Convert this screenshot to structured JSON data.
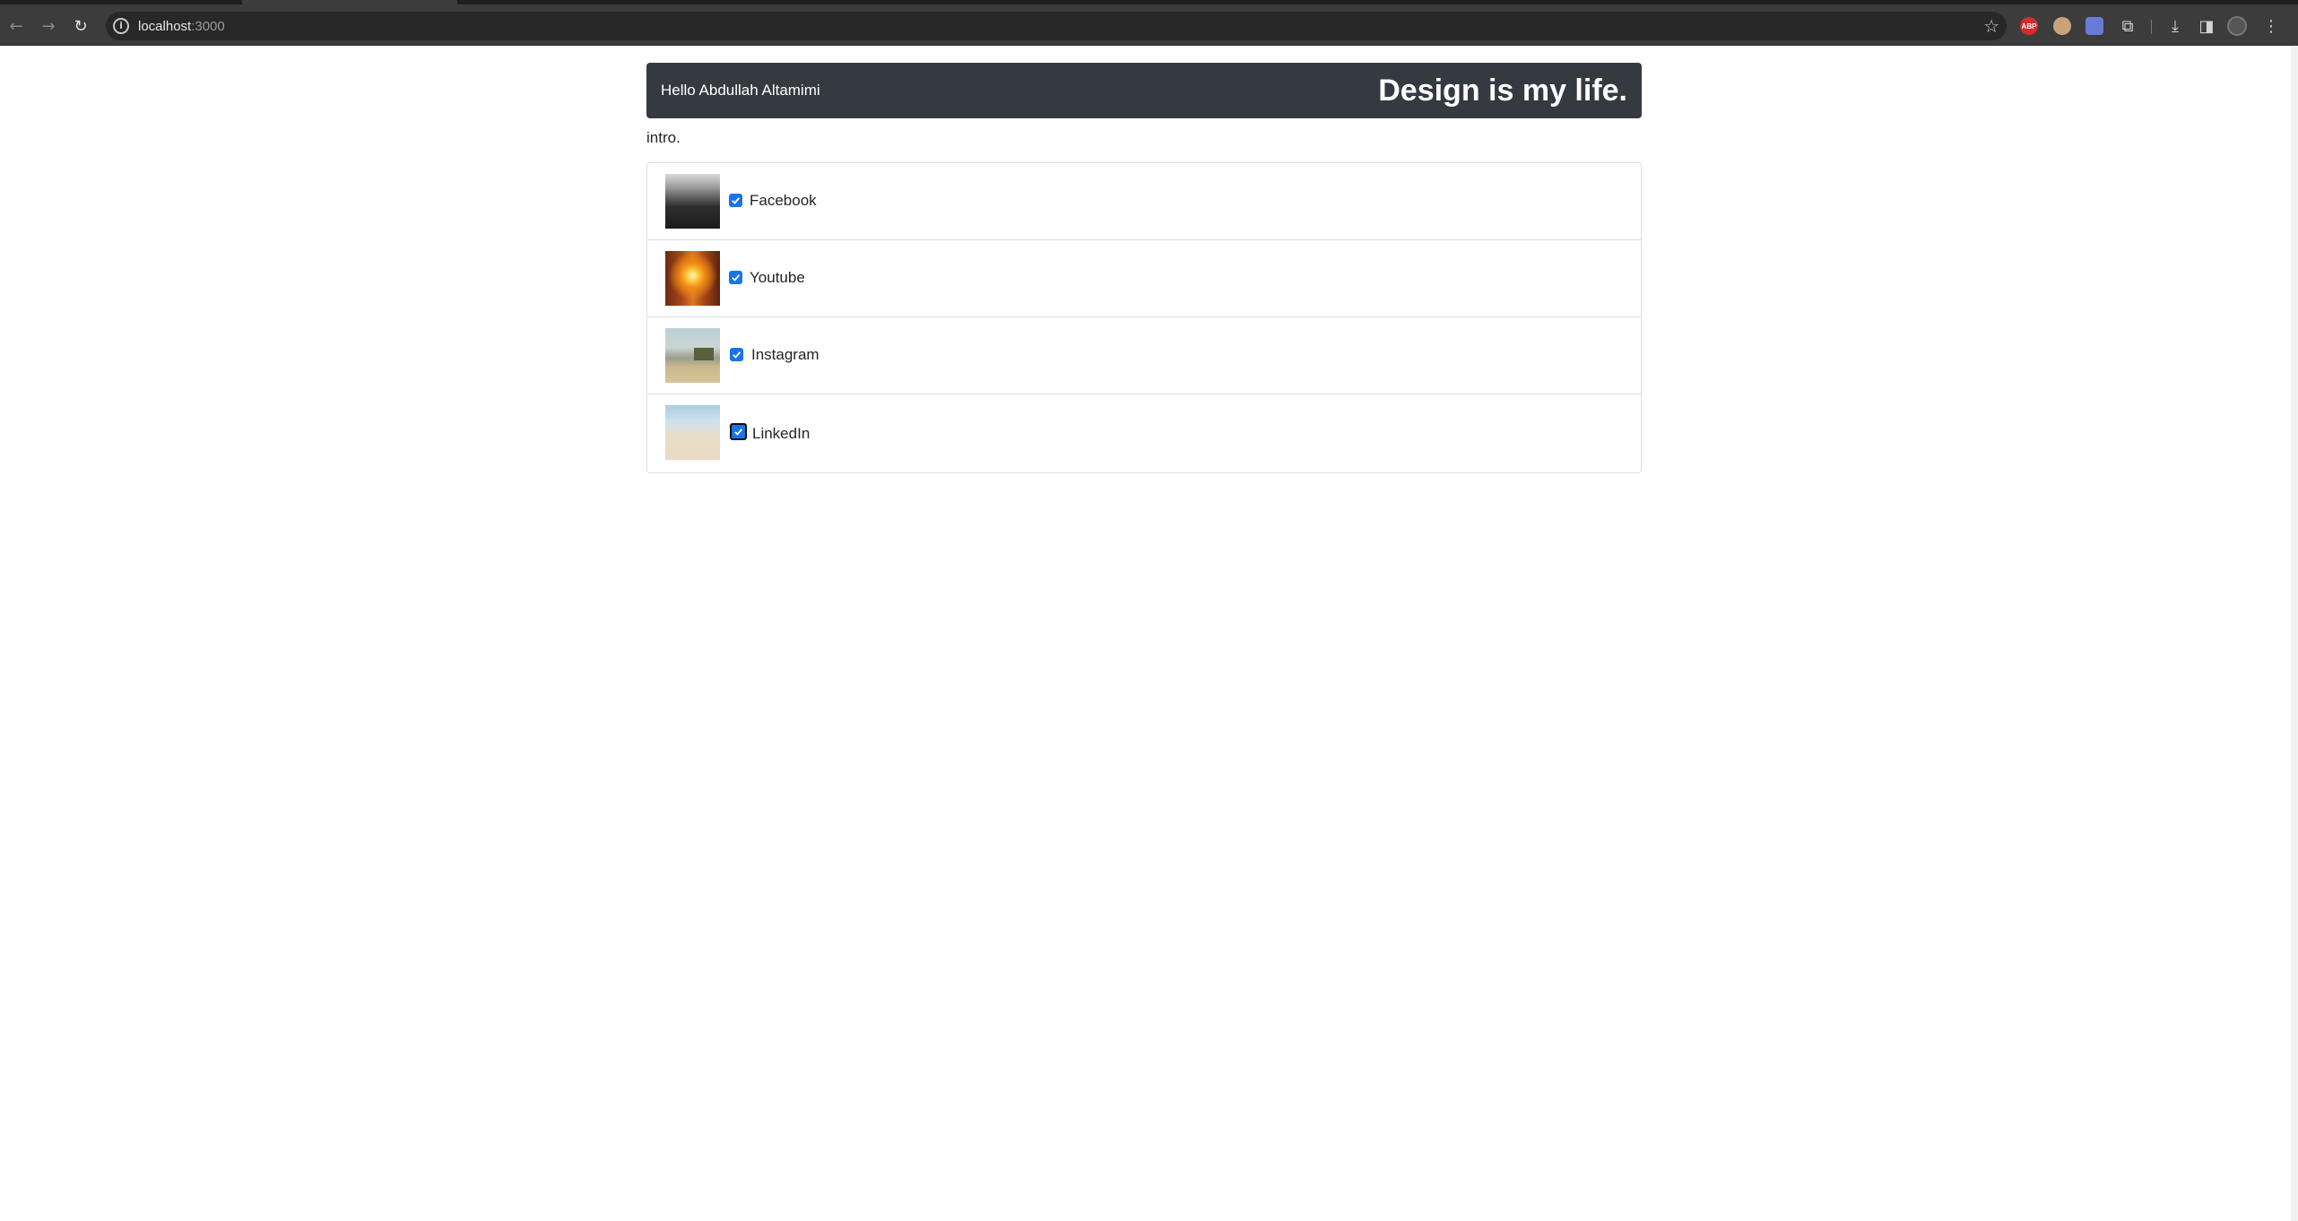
{
  "browser": {
    "address_host": "localhost",
    "address_port": ":3000",
    "icons": {
      "back": "arrow-left-icon",
      "forward": "arrow-right-icon",
      "reload": "reload-icon",
      "info": "info-icon",
      "bookmark": "star-icon",
      "downloads": "download-icon",
      "side_panel": "side-panel-icon",
      "extensions": "puzzle-icon",
      "menu": "kebab-menu-icon"
    }
  },
  "navbar": {
    "greeting": "Hello Abdullah Altamimi",
    "brand": "Design is my life."
  },
  "intro": "intro.",
  "items": [
    {
      "label": "Facebook",
      "checked": true
    },
    {
      "label": "Youtube",
      "checked": true
    },
    {
      "label": "Instagram",
      "checked": true
    },
    {
      "label": "LinkedIn",
      "checked": true,
      "focused": true
    }
  ],
  "colors": {
    "navbar_bg": "#343a40",
    "checkbox": "#1a73e8"
  }
}
